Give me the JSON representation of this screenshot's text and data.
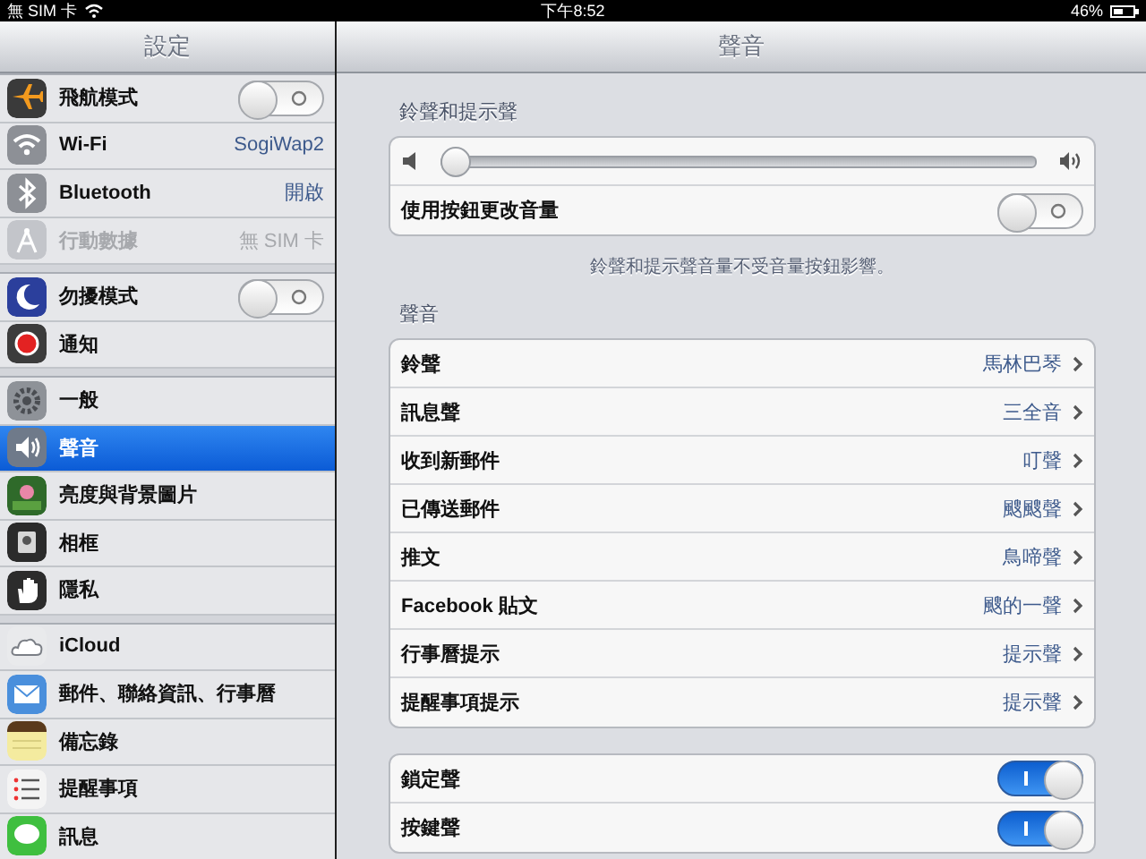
{
  "status_bar": {
    "carrier": "無 SIM 卡",
    "time": "下午8:52",
    "battery": "46%"
  },
  "sidebar": {
    "title": "設定",
    "groups": [
      {
        "items": [
          {
            "label": "飛航模式",
            "kind": "toggle",
            "on": false,
            "disabled": false,
            "selected": false
          },
          {
            "label": "Wi-Fi",
            "kind": "value",
            "value": "SogiWap2",
            "disabled": false,
            "selected": false
          },
          {
            "label": "Bluetooth",
            "kind": "value",
            "value": "開啟",
            "disabled": false,
            "selected": false
          },
          {
            "label": "行動數據",
            "kind": "value",
            "value": "無 SIM 卡",
            "disabled": true,
            "selected": false
          }
        ]
      },
      {
        "items": [
          {
            "label": "勿擾模式",
            "kind": "toggle",
            "on": false,
            "disabled": false,
            "selected": false
          },
          {
            "label": "通知",
            "kind": "plain",
            "disabled": false,
            "selected": false
          }
        ]
      },
      {
        "items": [
          {
            "label": "一般",
            "kind": "plain",
            "disabled": false,
            "selected": false
          },
          {
            "label": "聲音",
            "kind": "plain",
            "disabled": false,
            "selected": true
          },
          {
            "label": "亮度與背景圖片",
            "kind": "plain",
            "disabled": false,
            "selected": false
          },
          {
            "label": "相框",
            "kind": "plain",
            "disabled": false,
            "selected": false
          },
          {
            "label": "隱私",
            "kind": "plain",
            "disabled": false,
            "selected": false
          }
        ]
      },
      {
        "items": [
          {
            "label": "iCloud",
            "kind": "plain",
            "disabled": false,
            "selected": false
          },
          {
            "label": "郵件、聯絡資訊、行事曆",
            "kind": "plain",
            "disabled": false,
            "selected": false
          },
          {
            "label": "備忘錄",
            "kind": "plain",
            "disabled": false,
            "selected": false
          },
          {
            "label": "提醒事項",
            "kind": "plain",
            "disabled": false,
            "selected": false
          },
          {
            "label": "訊息",
            "kind": "plain",
            "disabled": false,
            "selected": false
          }
        ]
      }
    ]
  },
  "detail": {
    "title": "聲音",
    "sections": [
      {
        "header": "鈴聲和提示聲",
        "rows": [
          {
            "kind": "slider",
            "level": 0.0
          },
          {
            "kind": "toggle",
            "label": "使用按鈕更改音量",
            "on": false
          }
        ],
        "footer": "鈴聲和提示聲音量不受音量按鈕影響。"
      },
      {
        "header": "聲音",
        "rows": [
          {
            "kind": "value",
            "label": "鈴聲",
            "value": "馬林巴琴"
          },
          {
            "kind": "value",
            "label": "訊息聲",
            "value": "三全音"
          },
          {
            "kind": "value",
            "label": "收到新郵件",
            "value": "叮聲"
          },
          {
            "kind": "value",
            "label": "已傳送郵件",
            "value": "颼颼聲"
          },
          {
            "kind": "value",
            "label": "推文",
            "value": "鳥啼聲"
          },
          {
            "kind": "value",
            "label": "Facebook 貼文",
            "value": "颼的一聲"
          },
          {
            "kind": "value",
            "label": "行事曆提示",
            "value": "提示聲"
          },
          {
            "kind": "value",
            "label": "提醒事項提示",
            "value": "提示聲"
          }
        ]
      },
      {
        "rows": [
          {
            "kind": "toggle",
            "label": "鎖定聲",
            "on": true
          },
          {
            "kind": "toggle",
            "label": "按鍵聲",
            "on": true
          }
        ]
      }
    ]
  }
}
